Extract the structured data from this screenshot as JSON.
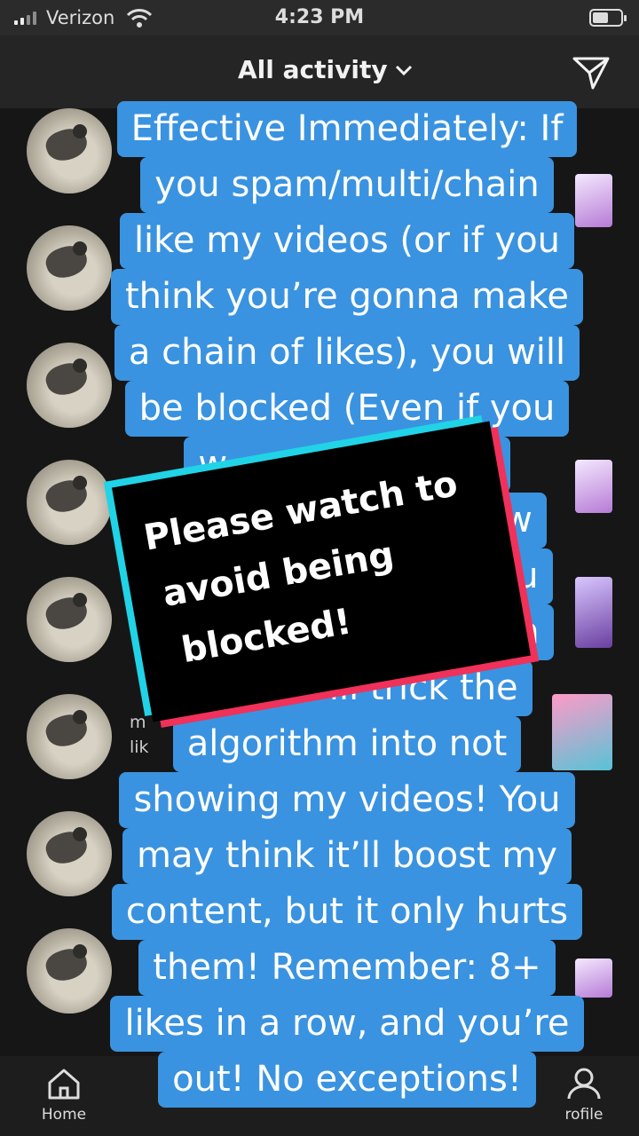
{
  "status_bar": {
    "carrier": "Verizon",
    "time": "4:23 PM",
    "battery_level": 0.55
  },
  "header": {
    "title": "All activity",
    "icons": [
      "chevron-down-icon",
      "send-icon"
    ]
  },
  "activity": {
    "rows": [
      {
        "avatar": "cat-avatar"
      },
      {
        "avatar": "cat-avatar"
      },
      {
        "avatar": "cat-avatar"
      },
      {
        "avatar": "cat-avatar"
      },
      {
        "avatar": "cat-avatar"
      },
      {
        "avatar": "cat-avatar",
        "text_line1": "m",
        "text_line2": "lik"
      },
      {
        "avatar": "cat-avatar"
      },
      {
        "avatar": "cat-avatar"
      }
    ]
  },
  "caption": {
    "lines": [
      "Effective Immediately: If",
      "you spam/multi/chain",
      "like my videos (or if you",
      "think you’re gonna make",
      "a chain of likes), you will",
      "be blocked (Even if you",
      "w                    ay",
      "th                        few",
      "                              ou",
      "                               m",
      "        g will trick the",
      "algorithm into not",
      "showing my videos! You",
      "may think it’ll boost my",
      "content, but it only hurts",
      "them! Remember: 8+",
      "likes in a row, and you’re",
      "out! No exceptions!"
    ]
  },
  "sticker": {
    "line1": "Please watch to",
    "line2": "avoid being",
    "line3": "blocked!"
  },
  "bottom_nav": {
    "home_label": "Home",
    "profile_label": "rofile"
  },
  "colors": {
    "caption_bg": "#3a93e0",
    "sticker_cyan": "#21d3e6",
    "sticker_red": "#f0315a"
  }
}
